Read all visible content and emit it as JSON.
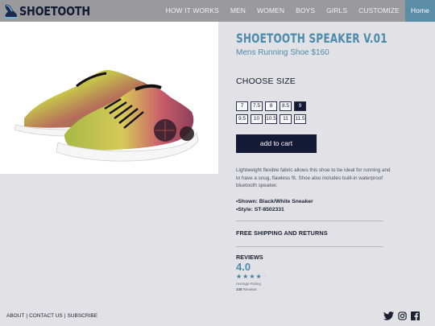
{
  "brand": {
    "name": "SHOETOOTH",
    "logo_icon": "shoe-logo-icon"
  },
  "nav": {
    "links": [
      "HOW IT WORKS",
      "MEN",
      "WOMEN",
      "BOYS",
      "GIRLS",
      "CUSTOMIZE",
      "Home"
    ],
    "active": "Home"
  },
  "product": {
    "title": "SHOETOOTH SPEAKER V.01",
    "subtitle": "Mens Running Shoe $160",
    "size_heading": "CHOOSE SIZE",
    "sizes_row1": [
      "7",
      "7.5",
      "8",
      "8.5",
      "9"
    ],
    "sizes_row2": [
      "9.5",
      "10",
      "10.5",
      "11",
      "11.5"
    ],
    "selected_size": "9",
    "cart_label": "add to cart",
    "description": "Lightweight flexible fabric allows this shoe to be ideal for running and to have a snug, flawless fit. Shoe also includes built-in waterproof bluetooth speaker.",
    "shown": "•Shown: Black/White Sneaker",
    "style": "•Style: ST-8502331",
    "shipping": "FREE SHIPPING AND RETURNS"
  },
  "reviews": {
    "heading": "REVIEWS",
    "rating": "4.0",
    "stars_filled": 4,
    "stars_total": 5,
    "avg_label": "Average Rating",
    "count_number": "338",
    "count_label": "Reviews"
  },
  "footer": {
    "links": [
      "ABOUT",
      "CONTACT US",
      "SUBSCRIBE"
    ],
    "social_icons": [
      "twitter-icon",
      "instagram-icon",
      "facebook-icon"
    ]
  },
  "colors": {
    "nav_bg": "#9a9a9d",
    "accent": "#4a8cab",
    "active_nav": "#5b8ea6",
    "dark": "#141a35",
    "page_bg": "#e2e2e6"
  }
}
